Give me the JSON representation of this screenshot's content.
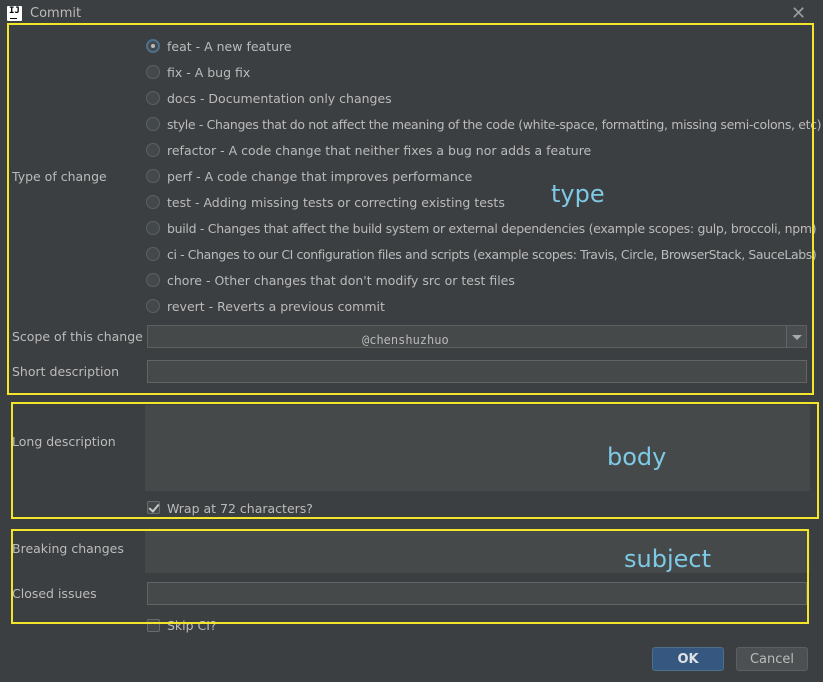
{
  "window": {
    "title": "Commit",
    "icon_text": "IJ"
  },
  "type_section": {
    "label": "Type of change",
    "options": [
      {
        "label": "feat - A new feature",
        "checked": true
      },
      {
        "label": "fix - A bug fix",
        "checked": false
      },
      {
        "label": "docs - Documentation only changes",
        "checked": false
      },
      {
        "label": "style - Changes that do not affect the meaning of the code (white-space, formatting, missing semi-colons, etc)",
        "checked": false
      },
      {
        "label": "refactor - A code change that neither fixes a bug nor adds a feature",
        "checked": false
      },
      {
        "label": "perf - A code change that improves performance",
        "checked": false
      },
      {
        "label": "test - Adding missing tests or correcting existing tests",
        "checked": false
      },
      {
        "label": "build - Changes that affect the build system or external dependencies (example scopes: gulp, broccoli, npm)",
        "checked": false
      },
      {
        "label": "ci - Changes to our CI configuration files and scripts (example scopes: Travis, Circle, BrowserStack, SauceLabs)",
        "checked": false
      },
      {
        "label": "chore - Other changes that don't modify src or test files",
        "checked": false
      },
      {
        "label": "revert - Reverts a previous commit",
        "checked": false
      }
    ]
  },
  "scope": {
    "label": "Scope of this change",
    "value": ""
  },
  "watermark": "@chenshuzhuo",
  "short_description": {
    "label": "Short description",
    "value": ""
  },
  "long_description": {
    "label": "Long description",
    "value": ""
  },
  "wrap": {
    "label": "Wrap at 72 characters?",
    "checked": true
  },
  "breaking_changes": {
    "label": "Breaking changes",
    "value": ""
  },
  "closed_issues": {
    "label": "Closed issues",
    "value": ""
  },
  "skip_ci": {
    "label": "Skip CI?",
    "checked": false
  },
  "buttons": {
    "ok": "OK",
    "cancel": "Cancel"
  },
  "annotations": {
    "type": "type",
    "body": "body",
    "subject": "subject",
    "color": "#f2e52a",
    "text_color": "#7ec9e5"
  },
  "colors": {
    "background": "#3c3f41",
    "field": "#45494a",
    "ok_button": "#365880"
  }
}
